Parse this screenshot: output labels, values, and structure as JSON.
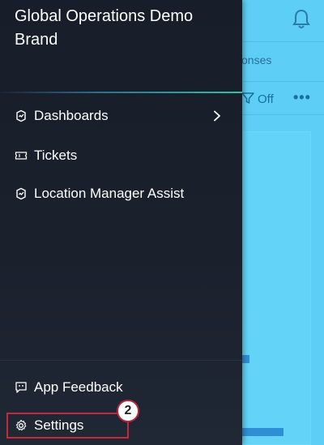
{
  "background_app": {
    "tab_partial_label": "onses",
    "filter_label": "Off",
    "more_label": "•••"
  },
  "drawer": {
    "brand_title": "Global Operations Demo Brand",
    "nav_items": [
      {
        "label": "Dashboards",
        "icon": "dashboards-icon",
        "has_submenu": true
      },
      {
        "label": "Tickets",
        "icon": "ticket-icon",
        "has_submenu": false
      },
      {
        "label": "Location Manager Assist",
        "icon": "location-manager-icon",
        "has_submenu": false
      }
    ],
    "footer_items": [
      {
        "label": "App Feedback",
        "icon": "feedback-icon"
      },
      {
        "label": "Settings",
        "icon": "gear-icon"
      }
    ]
  },
  "annotation": {
    "callout_number": "2",
    "highlight_color": "#c8283c"
  },
  "colors": {
    "drawer_background": "#1a202c",
    "app_background": "#5dcff6",
    "accent_line": "#2fc2a8"
  }
}
